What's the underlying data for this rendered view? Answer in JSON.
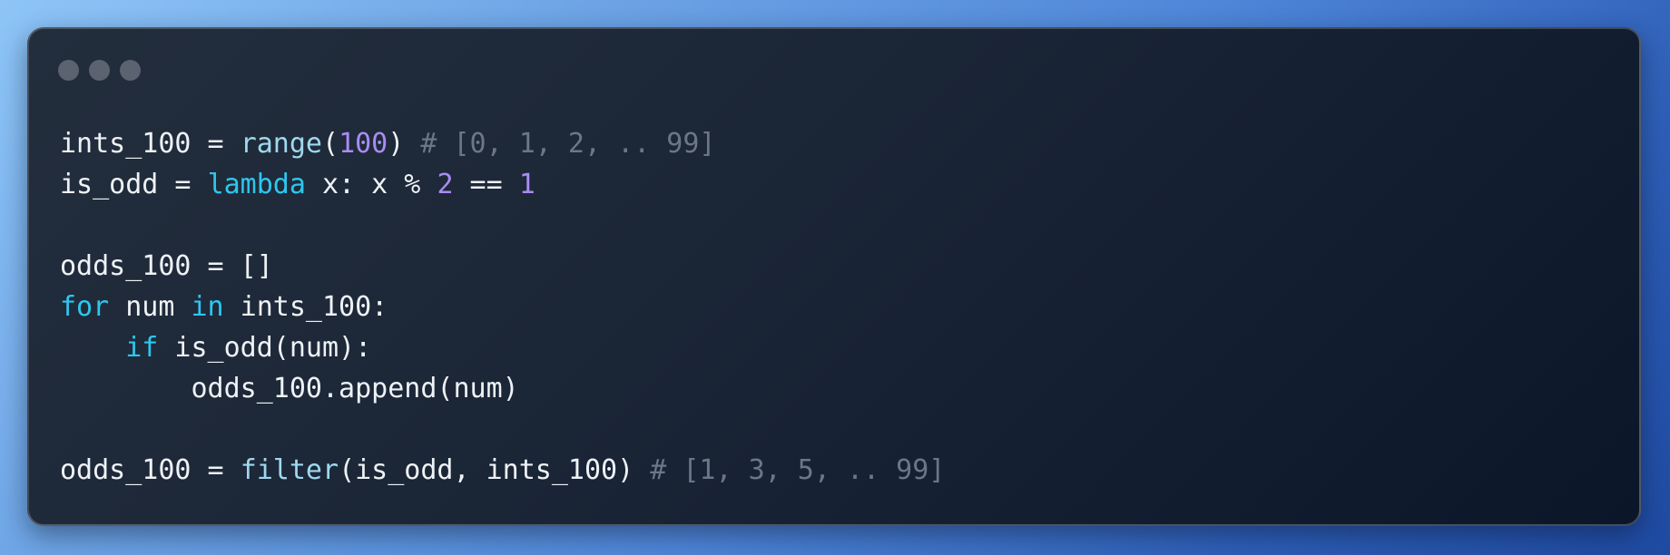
{
  "window": {
    "controls": [
      "window-dot-1",
      "window-dot-2",
      "window-dot-3"
    ]
  },
  "code": {
    "line1": {
      "a": "ints_100 = ",
      "fn": "range",
      "b": "(",
      "num": "100",
      "c": ") ",
      "comment": "# [0, 1, 2, .. 99]"
    },
    "line2": {
      "a": "is_odd = ",
      "kw": "lambda",
      "b": " x: x % ",
      "num1": "2",
      "c": " == ",
      "num2": "1"
    },
    "line3": {
      "text": ""
    },
    "line4": {
      "text": "odds_100 = []"
    },
    "line5": {
      "kw1": "for",
      "a": " num ",
      "kw2": "in",
      "b": " ints_100:"
    },
    "line6": {
      "indent": "    ",
      "kw": "if",
      "a": " is_odd(num):"
    },
    "line7": {
      "text": "        odds_100.append(num)"
    },
    "line8": {
      "text": ""
    },
    "line9": {
      "a": "odds_100 = ",
      "fn": "filter",
      "b": "(is_odd, ints_100) ",
      "comment": "# [1, 3, 5, .. 99]"
    }
  },
  "colors": {
    "keyword": "#2dc7ef",
    "function": "#9fd8ee",
    "number": "#a98cf2",
    "comment": "#6b7786",
    "text": "#eef2f6",
    "window_dot": "#5a636f"
  }
}
